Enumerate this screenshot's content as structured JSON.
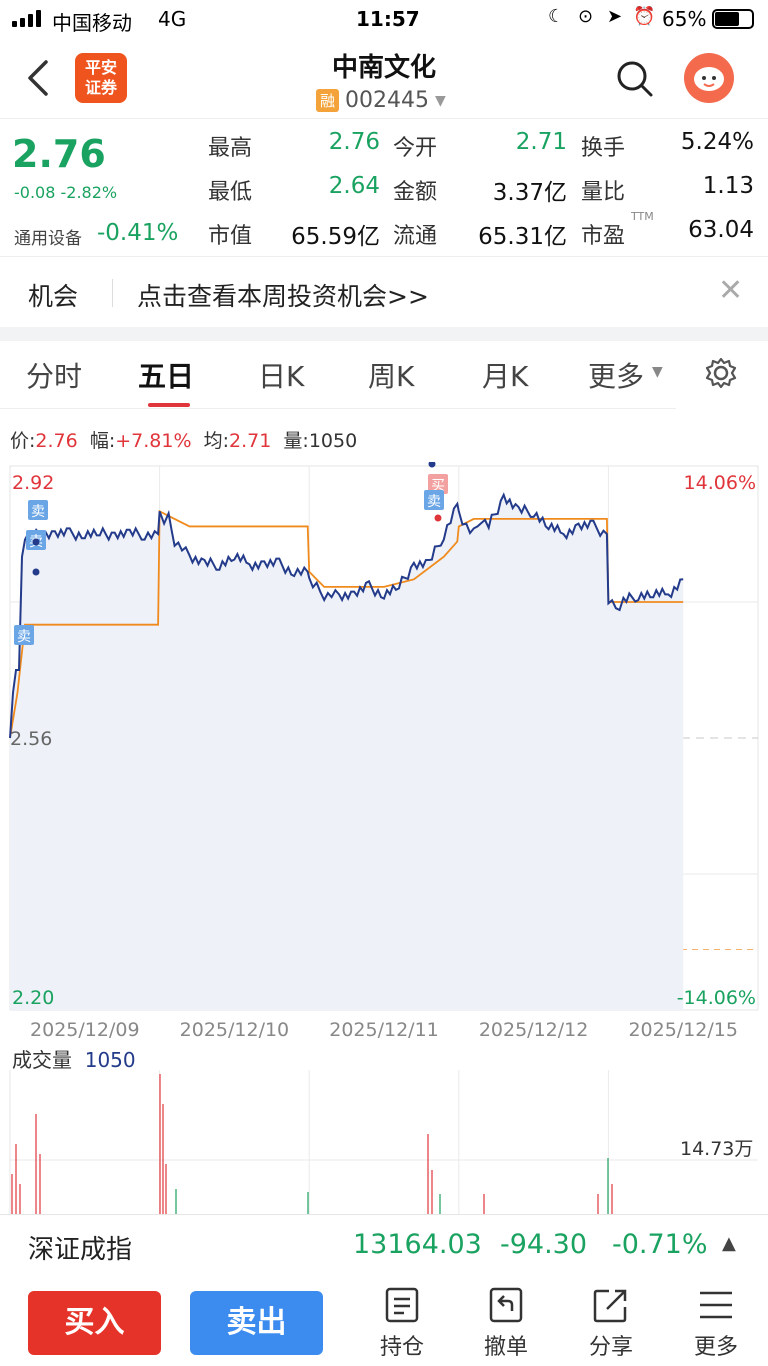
{
  "status_bar": {
    "carrier": "中国移动",
    "network": "4G",
    "time": "11:57",
    "battery": "65%"
  },
  "header": {
    "logo_line1": "平安",
    "logo_line2": "证券",
    "stock_name": "中南文化",
    "badge": "融",
    "code": "002445"
  },
  "quote": {
    "price": "2.76",
    "change": "-0.08",
    "change_pct": "-2.82%",
    "sector": "通用设备",
    "sector_change": "-0.41%",
    "rows": [
      [
        {
          "l": "最高",
          "v": "2.76",
          "c": "green"
        },
        {
          "l": "今开",
          "v": "2.71",
          "c": "green"
        },
        {
          "l": "换手",
          "v": "5.24%",
          "c": "dark"
        }
      ],
      [
        {
          "l": "最低",
          "v": "2.64",
          "c": "green"
        },
        {
          "l": "金额",
          "v": "3.37亿",
          "c": "dark"
        },
        {
          "l": "量比",
          "v": "1.13",
          "c": "dark"
        }
      ],
      [
        {
          "l": "市值",
          "v": "65.59亿",
          "c": "dark"
        },
        {
          "l": "流通",
          "v": "65.31亿",
          "c": "dark"
        },
        {
          "l": "市盈",
          "v": "63.04",
          "c": "dark",
          "sup": "TTM"
        }
      ]
    ]
  },
  "banner": {
    "tag": "机会",
    "text": "点击查看本周投资机会>>"
  },
  "tabs": [
    "分时",
    "五日",
    "日K",
    "周K",
    "月K",
    "更多"
  ],
  "active_tab": 1,
  "info_line": {
    "price_label": "价:",
    "price": "2.76",
    "amp_label": "幅:",
    "amp": "+7.81%",
    "avg_label": "均:",
    "avg": "2.71",
    "vol_label": "量:",
    "vol": "1050"
  },
  "chart_data": {
    "type": "line",
    "title": "",
    "y_left_ticks": [
      "2.92",
      "2.56",
      "2.20"
    ],
    "y_right_ticks": [
      "14.06%",
      "-14.06%"
    ],
    "ylim": [
      2.2,
      2.92
    ],
    "x_labels": [
      "2025/12/09",
      "2025/12/10",
      "2025/12/11",
      "2025/12/12",
      "2025/12/15"
    ],
    "markers": [
      {
        "label": "卖",
        "type": "sell"
      },
      {
        "label": "卖",
        "type": "sell"
      },
      {
        "label": "卖",
        "type": "sell"
      },
      {
        "label": "买",
        "type": "buy"
      },
      {
        "label": "卖",
        "type": "sell"
      }
    ],
    "series": [
      {
        "name": "价",
        "color": "#233b8a",
        "x": [
          0,
          0.02,
          0.04,
          0.06,
          0.08,
          0.1,
          0.15,
          0.2,
          0.3,
          0.4,
          0.5,
          0.6,
          0.7,
          0.8,
          0.9,
          0.99,
          1.0,
          1.03,
          1.06,
          1.1,
          1.15,
          1.2,
          1.3,
          1.4,
          1.5,
          1.6,
          1.7,
          1.8,
          1.9,
          1.99,
          2.0,
          2.05,
          2.1,
          2.15,
          2.2,
          2.3,
          2.4,
          2.5,
          2.6,
          2.7,
          2.8,
          2.9,
          2.99,
          3.0,
          3.05,
          3.1,
          3.15,
          3.2,
          3.3,
          3.4,
          3.5,
          3.6,
          3.7,
          3.8,
          3.9,
          3.99,
          4.0,
          4.05,
          4.1,
          4.2,
          4.3,
          4.4,
          4.5
        ],
        "y": [
          2.56,
          2.62,
          2.65,
          2.65,
          2.8,
          2.83,
          2.83,
          2.83,
          2.83,
          2.83,
          2.83,
          2.83,
          2.83,
          2.83,
          2.83,
          2.83,
          2.86,
          2.84,
          2.85,
          2.82,
          2.81,
          2.8,
          2.79,
          2.79,
          2.8,
          2.79,
          2.79,
          2.79,
          2.78,
          2.78,
          2.77,
          2.76,
          2.75,
          2.75,
          2.75,
          2.75,
          2.76,
          2.75,
          2.76,
          2.79,
          2.79,
          2.83,
          2.87,
          2.86,
          2.84,
          2.83,
          2.85,
          2.84,
          2.88,
          2.86,
          2.86,
          2.84,
          2.83,
          2.84,
          2.84,
          2.83,
          2.74,
          2.73,
          2.74,
          2.75,
          2.75,
          2.75,
          2.77
        ]
      },
      {
        "name": "均",
        "color": "#f08a1c",
        "x": [
          0,
          0.05,
          0.1,
          0.2,
          0.5,
          0.99,
          1.0,
          1.1,
          1.2,
          1.3,
          1.5,
          1.99,
          2.0,
          2.05,
          2.1,
          2.2,
          2.5,
          2.7,
          2.9,
          2.99,
          3.0,
          3.1,
          3.3,
          3.5,
          3.7,
          3.9,
          3.99,
          4.0,
          4.1,
          4.3,
          4.5
        ],
        "y": [
          2.56,
          2.62,
          2.71,
          2.71,
          2.71,
          2.71,
          2.86,
          2.85,
          2.84,
          2.84,
          2.84,
          2.84,
          2.78,
          2.77,
          2.76,
          2.76,
          2.76,
          2.77,
          2.8,
          2.82,
          2.84,
          2.85,
          2.85,
          2.85,
          2.85,
          2.85,
          2.85,
          2.74,
          2.74,
          2.74,
          2.74
        ]
      }
    ]
  },
  "volume": {
    "label": "成交量",
    "value": "1050",
    "scale": "14.73万"
  },
  "index_bar": {
    "name": "深证成指",
    "value": "13164.03",
    "change": "-94.30",
    "change_pct": "-0.71%"
  },
  "toolbar": {
    "buy": "买入",
    "sell": "卖出",
    "hold": "持仓",
    "cancel": "撤单",
    "share": "分享",
    "more": "更多"
  },
  "colors": {
    "up": "#e0353b",
    "down": "#1aa260",
    "price_line": "#233b8a",
    "avg_line": "#f08a1c",
    "buy_btn": "#e63329",
    "sell_btn": "#3c8cf0"
  }
}
